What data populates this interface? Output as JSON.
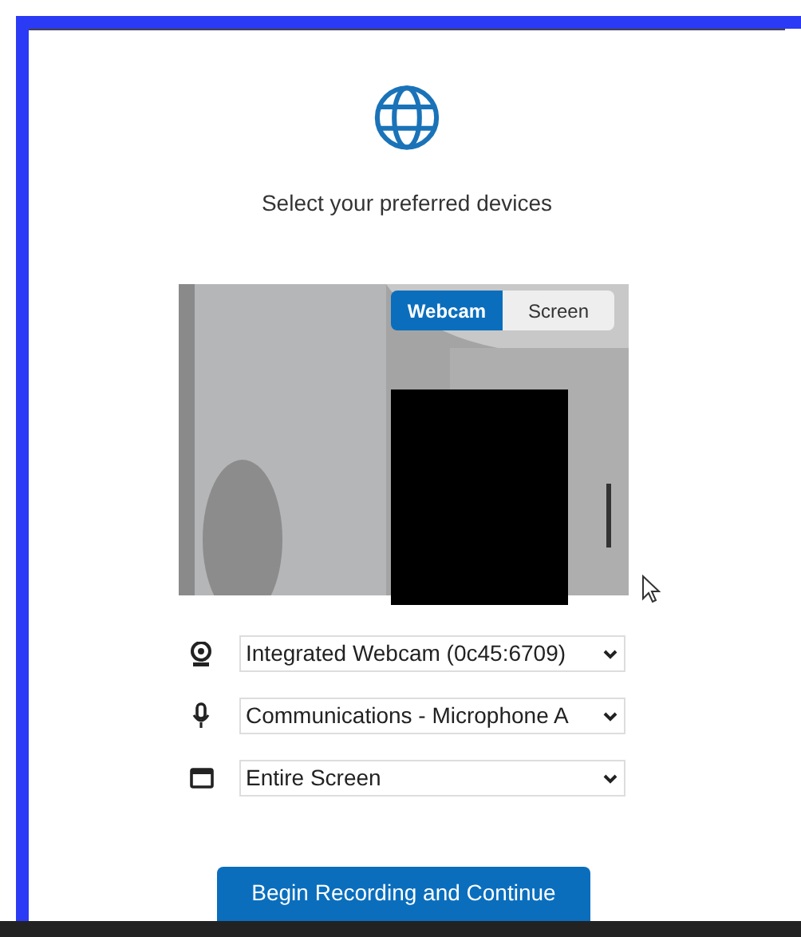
{
  "heading": "Select your preferred devices",
  "source_tabs": [
    {
      "label": "Webcam",
      "selected": true
    },
    {
      "label": "Screen",
      "selected": false
    }
  ],
  "devices": [
    {
      "kind": "webcam",
      "value": "Integrated Webcam (0c45:6709)"
    },
    {
      "kind": "microphone",
      "value": "Communications - Microphone A"
    },
    {
      "kind": "screen",
      "value": "Entire Screen"
    }
  ],
  "primary_button": "Begin Recording and Continue"
}
